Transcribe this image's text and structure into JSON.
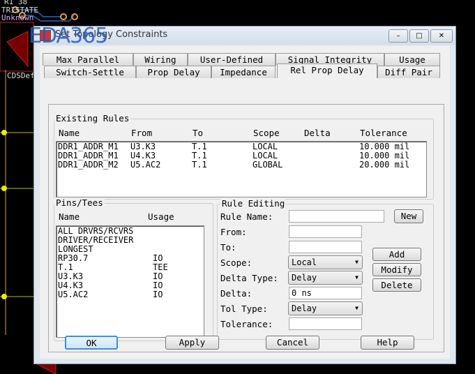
{
  "background": {
    "labels": [
      "R1 38",
      "TRISTATE",
      "Unknown",
      "CDSDef"
    ],
    "watermark": "EDA365"
  },
  "window": {
    "title": "Set Topology Constraints",
    "minimize": "–",
    "maximize": "□",
    "close": "✕"
  },
  "tabs_row1": [
    "Max Parallel",
    "Wiring",
    "User-Defined",
    "Signal Integrity",
    "Usage"
  ],
  "tabs_row2": [
    "Switch-Settle",
    "Prop Delay",
    "Impedance",
    "Rel Prop Delay",
    "Diff Pair"
  ],
  "active_tab": "Rel Prop Delay",
  "existing_rules": {
    "label": "Existing Rules",
    "columns": [
      "Name",
      "From",
      "To",
      "Scope",
      "Delta",
      "Tolerance"
    ],
    "rows": [
      [
        "DDR1_ADDR_M1",
        "U3.K3",
        "T.1",
        "LOCAL",
        "",
        "10.000 mil"
      ],
      [
        "DDR1_ADDR_M1",
        "U4.K3",
        "T.1",
        "LOCAL",
        "",
        "10.000 mil"
      ],
      [
        "DDR1_ADDR_M2",
        "U5.AC2",
        "T.1",
        "GLOBAL",
        "",
        "20.000 mil"
      ]
    ]
  },
  "pins_tees": {
    "label": "Pins/Tees",
    "columns": [
      "Name",
      "Usage"
    ],
    "rows": [
      [
        "ALL DRVRS/RCVRS",
        ""
      ],
      [
        "DRIVER/RECEIVER",
        ""
      ],
      [
        "LONGEST",
        ""
      ],
      [
        "RP30.7",
        "IO"
      ],
      [
        "T.1",
        "TEE"
      ],
      [
        "U3.K3",
        "IO"
      ],
      [
        "U4.K3",
        "IO"
      ],
      [
        "U5.AC2",
        "IO"
      ]
    ]
  },
  "rule_editing": {
    "label": "Rule Editing",
    "rule_name_label": "Rule Name:",
    "rule_name": "",
    "new": "New",
    "from_label": "From:",
    "from": "",
    "to_label": "To:",
    "to": "",
    "scope_label": "Scope:",
    "scope": "Local",
    "delta_type_label": "Delta Type:",
    "delta_type": "Delay",
    "delta_label": "Delta:",
    "delta": "0 ns",
    "tol_type_label": "Tol Type:",
    "tol_type": "Delay",
    "tolerance_label": "Tolerance:",
    "tolerance": "",
    "add": "Add",
    "modify": "Modify",
    "delete": "Delete"
  },
  "footer": {
    "ok": "OK",
    "apply": "Apply",
    "cancel": "Cancel",
    "help": "Help"
  }
}
